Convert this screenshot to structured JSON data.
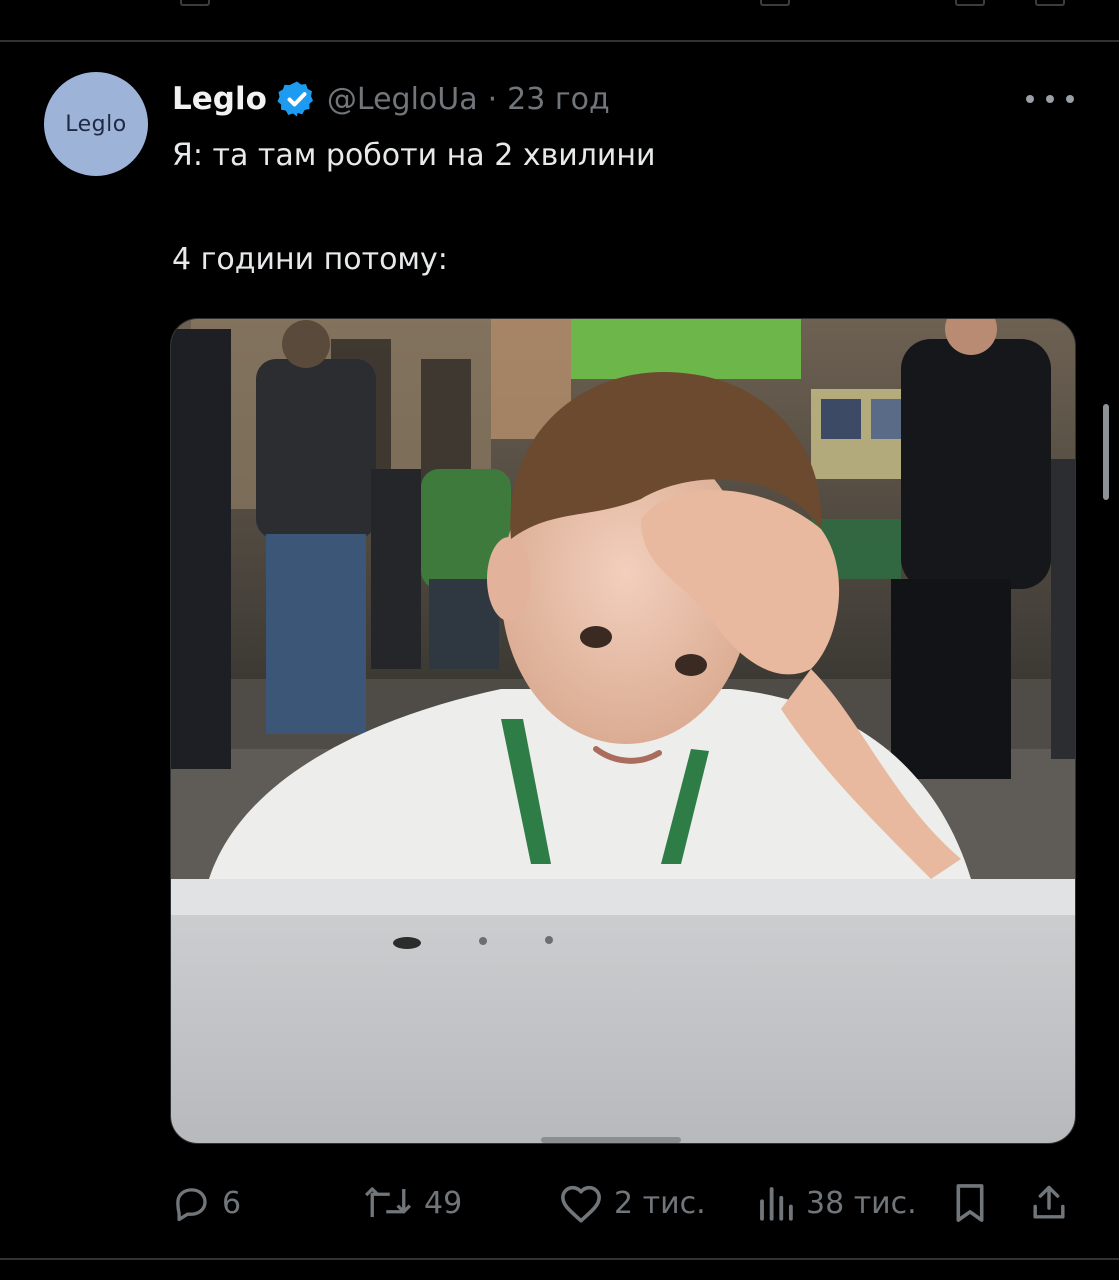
{
  "tweet": {
    "avatar_text": "Leglo",
    "display_name": "Leglo",
    "verified": true,
    "handle": "@LegloUa",
    "separator": "·",
    "time": "23 год",
    "text_line_1": "Я: та там роботи на 2 хвилини",
    "text_line_2": "4 години потому:"
  },
  "actions": {
    "replies": "6",
    "reposts": "49",
    "likes": "2 тис.",
    "views": "38 тис."
  },
  "icons": {
    "verified": "verified-badge-icon",
    "more": "more-dots-icon",
    "reply": "reply-bubble-icon",
    "repost": "repost-arrows-icon",
    "like": "heart-icon",
    "views": "bar-chart-icon",
    "bookmark": "bookmark-icon",
    "share": "share-upload-icon"
  },
  "colors": {
    "background": "#000000",
    "text_primary": "#e7e9ea",
    "text_secondary": "#71767b",
    "verified_blue": "#1d9bf0",
    "avatar_bg": "#9eb3d8",
    "divider": "#2f3336"
  }
}
